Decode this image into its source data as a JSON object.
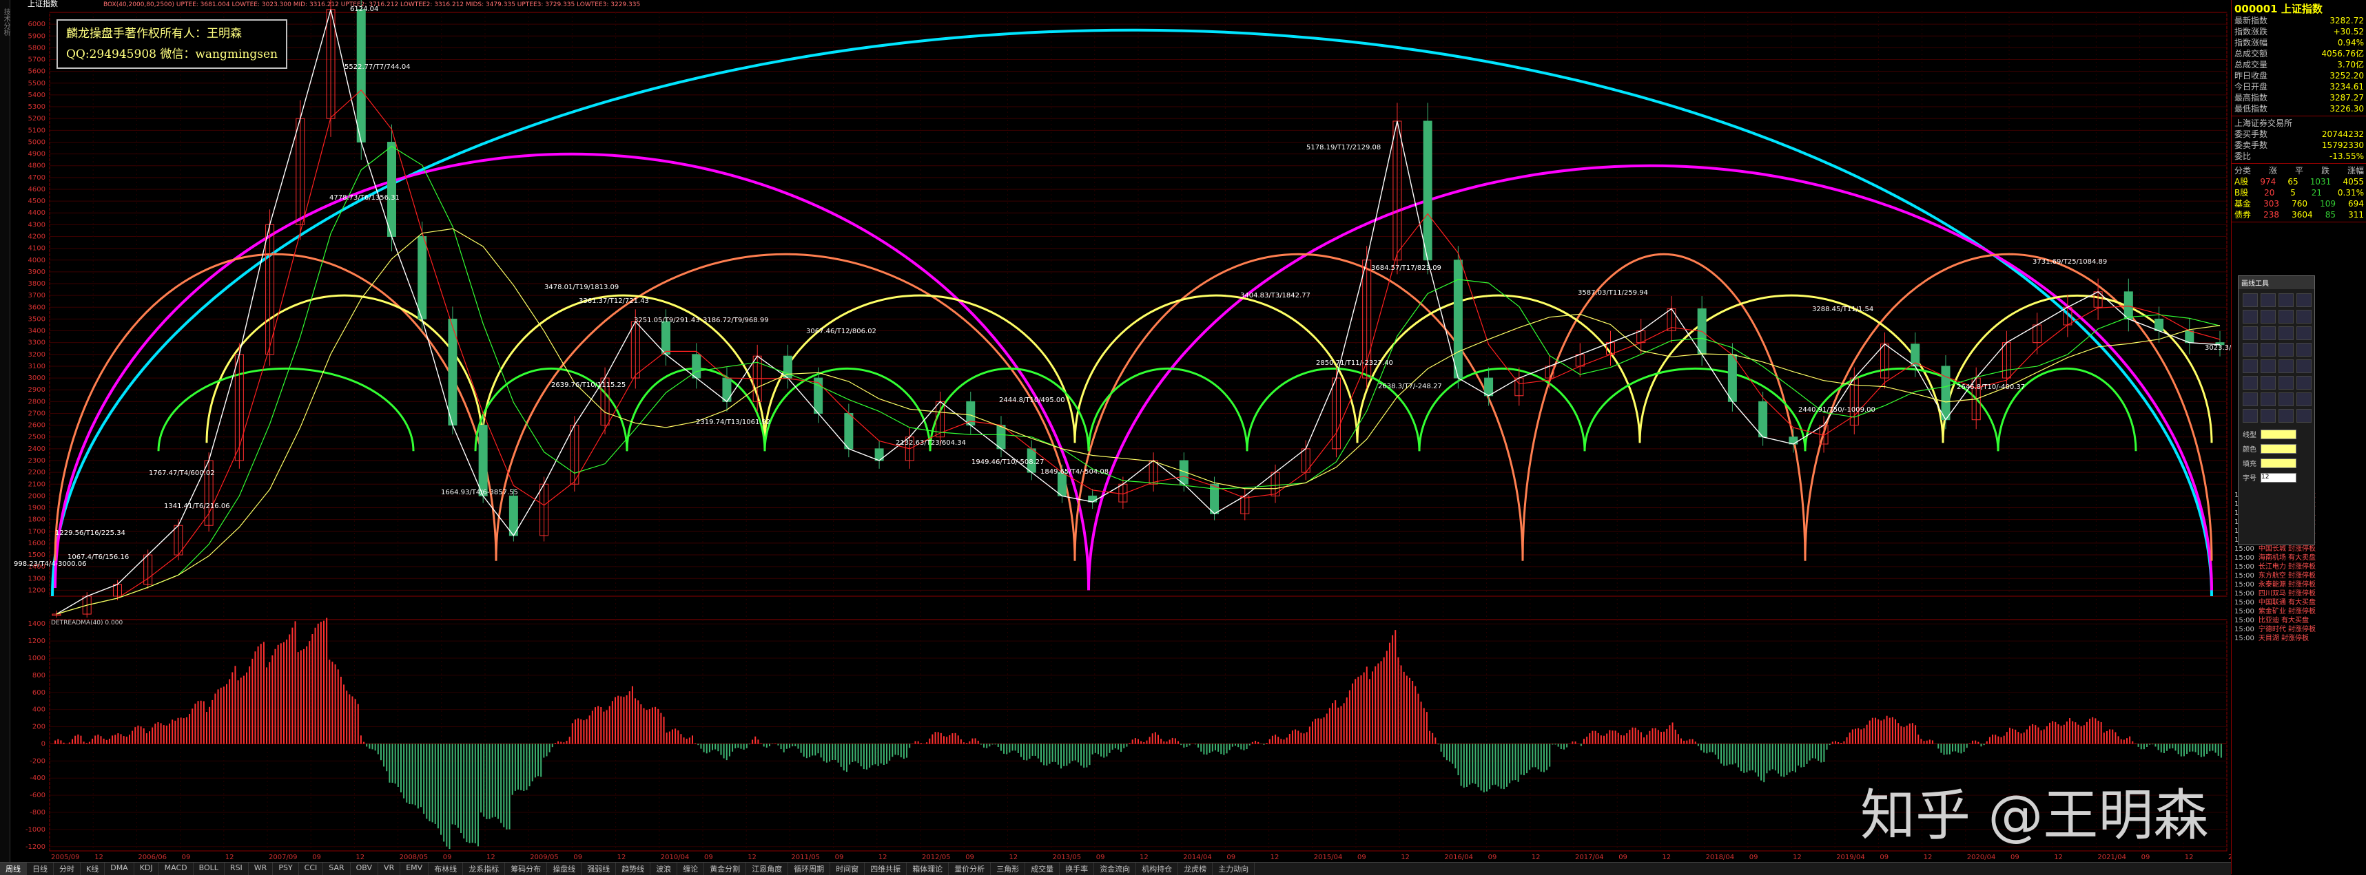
{
  "header": {
    "title": "上证指数",
    "indicator_line": "BOX(40,2000,80,2500)  UPTEE: 3681.004  LOWTEE: 3023.300  MID: 3316.212  UPTEE2: 3716.212  LOWTEE2: 3316.212  MIDS: 3479.335  UPTEE3: 3729.335  LOWTEE3: 3229.335"
  },
  "owner": {
    "line1": "麟龙操盘手著作权所有人：王明森",
    "line2": "QQ:294945908 微信：wangmingsen"
  },
  "watermark": "知乎 @王明森",
  "sub_title": "DETREADMA(40) 0.000",
  "quote": {
    "code_name": "000001 上证指数",
    "rows": [
      {
        "k": "最新指数",
        "v": "3282.72"
      },
      {
        "k": "指数涨跌",
        "v": "+30.52"
      },
      {
        "k": "指数涨幅",
        "v": "0.94%"
      },
      {
        "k": "总成交额",
        "v": "4056.76亿"
      },
      {
        "k": "总成交量",
        "v": "3.70亿"
      },
      {
        "k": "昨日收盘",
        "v": "3252.20"
      },
      {
        "k": "今日开盘",
        "v": "3234.61"
      },
      {
        "k": "最高指数",
        "v": "3287.27"
      },
      {
        "k": "最低指数",
        "v": "3226.30"
      }
    ],
    "exchange": "上海证券交易所",
    "rows2": [
      {
        "k": "委买手数",
        "v": "20744232"
      },
      {
        "k": "委卖手数",
        "v": "15792330"
      },
      {
        "k": "委比",
        "v": "-13.55%"
      }
    ],
    "breadth_header": [
      "分类",
      "涨",
      "平",
      "跌",
      "涨幅"
    ],
    "breadth": [
      [
        "A股",
        "974",
        "65",
        "1031",
        "4055"
      ],
      [
        "B股",
        "20",
        "5",
        "21",
        "0.31%"
      ],
      [
        "基金",
        "303",
        "760",
        "109",
        "694"
      ],
      [
        "债券",
        "238",
        "3604",
        "85",
        "311"
      ]
    ]
  },
  "tool_panel": {
    "title": "画线工具",
    "labels": [
      "线型",
      "颜色",
      "填充",
      "字号"
    ],
    "font_size": "12"
  },
  "trades": [
    {
      "t": "15:00",
      "n": "迎驾贡酒 有大买盘"
    },
    {
      "t": "15:00",
      "n": "通用股份 有大买盘"
    },
    {
      "t": "15:00",
      "n": "中国国航 封涨停板"
    },
    {
      "t": "15:00",
      "n": "贵州茅台 有大买盘"
    },
    {
      "t": "15:00",
      "n": "华电国际 封涨停板"
    },
    {
      "t": "15:00",
      "n": "亨通光电 封涨停板"
    },
    {
      "t": "15:00",
      "n": "中国长城 封涨停板"
    },
    {
      "t": "15:00",
      "n": "海南机场 有大卖盘"
    },
    {
      "t": "15:00",
      "n": "长江电力 封涨停板"
    },
    {
      "t": "15:00",
      "n": "东方航空 封涨停板"
    },
    {
      "t": "15:00",
      "n": "永泰能源 封涨停板"
    },
    {
      "t": "15:00",
      "n": "四川双马 封涨停板"
    },
    {
      "t": "15:00",
      "n": "中国联通 有大买盘"
    },
    {
      "t": "15:00",
      "n": "紫金矿业 封涨停板"
    },
    {
      "t": "15:00",
      "n": "比亚迪 有大买盘"
    },
    {
      "t": "15:00",
      "n": "宁德时代 封涨停板"
    },
    {
      "t": "15:00",
      "n": "天目湖 封涨停板"
    }
  ],
  "toolbar_tabs": [
    "周线",
    "日线",
    "分时",
    "K线",
    "DMA",
    "KDJ",
    "MACD",
    "BOLL",
    "RSI",
    "WR",
    "PSY",
    "CCI",
    "SAR",
    "OBV",
    "VR",
    "EMV",
    "布林线",
    "龙系指标",
    "筹码分布",
    "操盘线",
    "强弱线",
    "趋势线",
    "波浪",
    "缠论",
    "黄金分割",
    "江恩角度",
    "循环周期",
    "时间窗",
    "四维共振",
    "箱体理论",
    "量价分析",
    "三角形",
    "成交量",
    "换手率",
    "资金流向",
    "机构持仓",
    "龙虎榜",
    "主力动向"
  ],
  "right_tabs": [
    "日线",
    "分时",
    "周线"
  ],
  "colors": {
    "up": "#ff3030",
    "down": "#3cb371",
    "axis": "#8b0000",
    "cyan_arc": "#00e5ff",
    "magenta_arc": "#ff00ff",
    "orange_arc": "#ff7f50",
    "yellow_arc": "#ffff66",
    "green_arc": "#33ff33",
    "label": "#ffffff"
  },
  "chart_data": [
    {
      "type": "line",
      "title": "上证指数",
      "y_ticks": [
        1200,
        1300,
        1400,
        1500,
        1600,
        1700,
        1800,
        1900,
        2000,
        2100,
        2200,
        2300,
        2400,
        2500,
        2600,
        2700,
        2800,
        2900,
        3000,
        3100,
        3200,
        3300,
        3400,
        3500,
        3600,
        3700,
        3800,
        3900,
        4000,
        4100,
        4200,
        4300,
        4400,
        4500,
        4600,
        4700,
        4800,
        4900,
        5000,
        5100,
        5200,
        5300,
        5400,
        5500,
        5600,
        5700,
        5800,
        5900,
        6000
      ],
      "ylim": [
        1150,
        6100
      ],
      "x_ticks": [
        "2005/09",
        "12",
        "2006/06",
        "09",
        "12",
        "2007/09",
        "09",
        "12",
        "2008/05",
        "09",
        "12",
        "2009/05",
        "09",
        "12",
        "2010/04",
        "09",
        "12",
        "2011/05",
        "09",
        "12",
        "2012/05",
        "09",
        "12",
        "2013/05",
        "09",
        "12",
        "2014/04",
        "09",
        "12",
        "2015/04",
        "09",
        "12",
        "2016/04",
        "09",
        "12",
        "2017/04",
        "09",
        "12",
        "2018/04",
        "09",
        "12",
        "2019/04",
        "09",
        "12",
        "2020/04",
        "09",
        "12",
        "2021/04",
        "09",
        "12",
        "2022/04"
      ],
      "series": [
        {
          "name": "上证指数",
          "values": [
            998,
            1150,
            1250,
            1500,
            1750,
            2300,
            3200,
            4300,
            5200,
            6124,
            5000,
            4200,
            3500,
            2600,
            2000,
            1664,
            2100,
            2600,
            3000,
            3478,
            3200,
            3000,
            2800,
            3186,
            3000,
            2700,
            2400,
            2300,
            2500,
            2800,
            2600,
            2400,
            2200,
            2000,
            1949,
            2100,
            2300,
            2100,
            1849,
            2000,
            2200,
            2400,
            3000,
            4000,
            5178,
            4000,
            3000,
            2850,
            3000,
            3100,
            3200,
            3300,
            3400,
            3587,
            3200,
            2800,
            2500,
            2440,
            2600,
            3000,
            3288,
            3100,
            2646,
            3000,
            3300,
            3450,
            3600,
            3731,
            3500,
            3400,
            3300,
            3282
          ]
        }
      ],
      "annotations": [
        "6124.04",
        "5522.77/T7/744.04",
        "4778.73/T6/1356.31",
        "1664.93/T4/6-3857.55",
        "1767.47/T4/600.02",
        "1341.41/T6/216.06",
        "1229.56/T16/225.34",
        "998.23/T4/4-3000.06",
        "1067.4/T6/156.16",
        "3478.01/T19/1813.09",
        "3361.37/T12/721.43",
        "3251.05/T9/291.43",
        "3186.72/T9/968.99",
        "3067.46/T12/806.02",
        "2639.76/T10/1115.25",
        "2319.74/T13/1061.92",
        "2132.63/T23/604.34",
        "2444.8/T10/495.00",
        "1949.46/T10/-508.27",
        "1849.65/T4/-504.08",
        "5178.19/T17/2129.08",
        "3684.57/T17/823.09",
        "3404.83/T3/1842.77",
        "2850.71/T11/-2327.40",
        "2638.3/T7/-248.27",
        "3587.03/T11/259.94",
        "2440.91/T50/-1009.00",
        "3288.45/T11/1.54",
        "2646.8/T10/-400.37",
        "3731.69/T25/1084.89",
        "3023.3/T17/-200.02"
      ]
    },
    {
      "type": "bar",
      "title": "DETREADMA(40) 0.000",
      "y_ticks": [
        -1200,
        -1000,
        -800,
        -600,
        -400,
        -200,
        0,
        200,
        400,
        600,
        800,
        1000,
        1200,
        1400
      ],
      "ylim": [
        -1250,
        1450
      ]
    }
  ]
}
